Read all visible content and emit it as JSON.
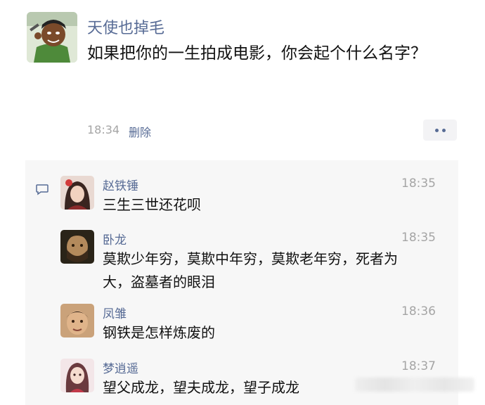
{
  "post": {
    "author": "天使也掉毛",
    "text": "如果把你的一生拍成电影，你会起个什么名字？",
    "time": "18:34",
    "delete_label": "删除"
  },
  "comments": [
    {
      "name": "赵铁锤",
      "time": "18:35",
      "text": "三生三世还花呗"
    },
    {
      "name": "卧龙",
      "time": "18:35",
      "text": "莫欺少年穷，莫欺中年穷，莫欺老年穷，死者为大，盗墓者的眼泪"
    },
    {
      "name": "凤雏",
      "time": "18:36",
      "text": "钢铁是怎样炼废的"
    },
    {
      "name": "梦逍遥",
      "time": "18:37",
      "text": "望父成龙，望夫成龙，望子成龙"
    }
  ],
  "colors": {
    "link": "#576b95",
    "meta": "#a5a5a5",
    "comment_bg": "#f7f7f7"
  },
  "icons": {
    "more": "more-dots-icon",
    "comment": "comment-bubble-icon"
  }
}
